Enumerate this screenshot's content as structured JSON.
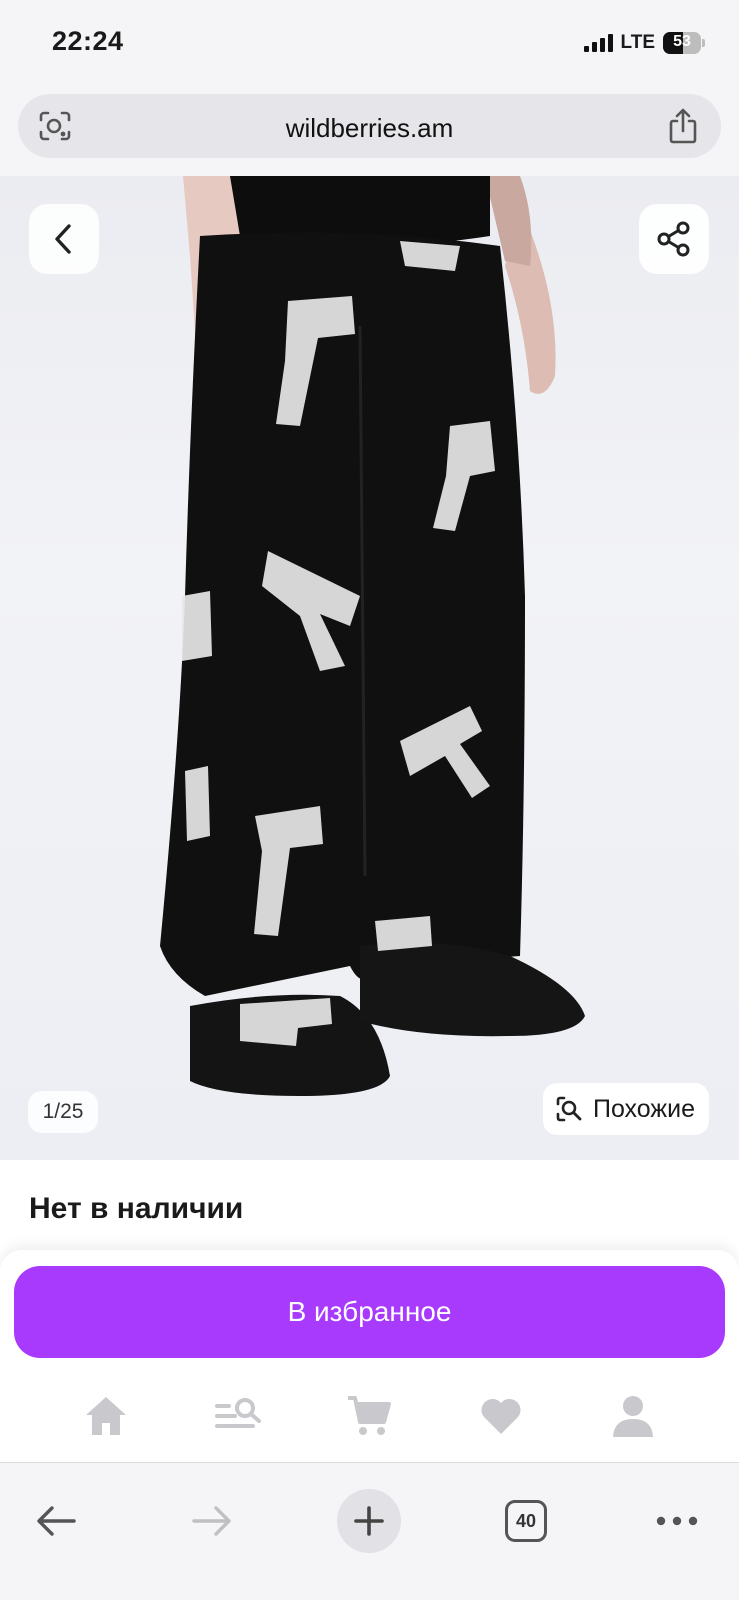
{
  "status_bar": {
    "time": "22:24",
    "network": "LTE",
    "battery_level": "53",
    "battery_fraction": 0.53
  },
  "browser": {
    "url": "wildberries.am",
    "open_tabs": "40",
    "icons": [
      "lens-icon",
      "share-icon",
      "back-arrow-icon",
      "forward-arrow-icon",
      "plus-icon",
      "tabs-icon",
      "more-icon"
    ]
  },
  "product": {
    "image_counter": "1/25",
    "similar_label": "Похожие",
    "availability": "Нет в наличии",
    "favorite_button": "В избранное"
  },
  "app_nav": {
    "items": [
      "home-icon",
      "catalog-search-icon",
      "cart-icon",
      "favorites-icon",
      "profile-icon"
    ]
  },
  "colors": {
    "accent": "#a73afd",
    "nav_icon": "#c9c9cd",
    "background": "#ffffff"
  }
}
